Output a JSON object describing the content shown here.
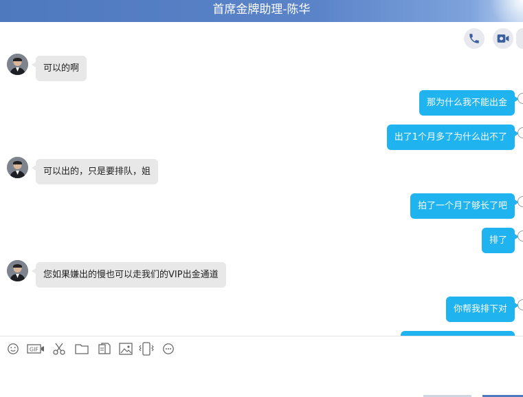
{
  "window": {
    "title": "首席金牌助理-陈华"
  },
  "header_actions": {
    "voice_call": "phone-icon",
    "video_call": "video-icon"
  },
  "messages": [
    {
      "side": "in",
      "text": "可以的啊"
    },
    {
      "side": "out",
      "text": "那为什么我不能出金"
    },
    {
      "side": "out",
      "text": "出了1个月多了为什么出不了"
    },
    {
      "side": "in",
      "text": "可以出的，只是要排队，姐"
    },
    {
      "side": "out",
      "text": "拍了一个月了够长了吧"
    },
    {
      "side": "out",
      "text": "排了"
    },
    {
      "side": "in",
      "text": "您如果嫌出的慢也可以走我们的VIP出金通道"
    },
    {
      "side": "out",
      "text": "你帮我排下对"
    }
  ],
  "toolbar": {
    "icons": [
      "emoji-icon",
      "gif-icon",
      "scissors-icon",
      "folder-icon",
      "files-icon",
      "image-icon",
      "shake-icon",
      "more-icon"
    ]
  },
  "colors": {
    "title_bar": "#5a83c8",
    "outgoing_bubble": "#1fb3f0",
    "incoming_bubble": "#e8e8e8"
  }
}
